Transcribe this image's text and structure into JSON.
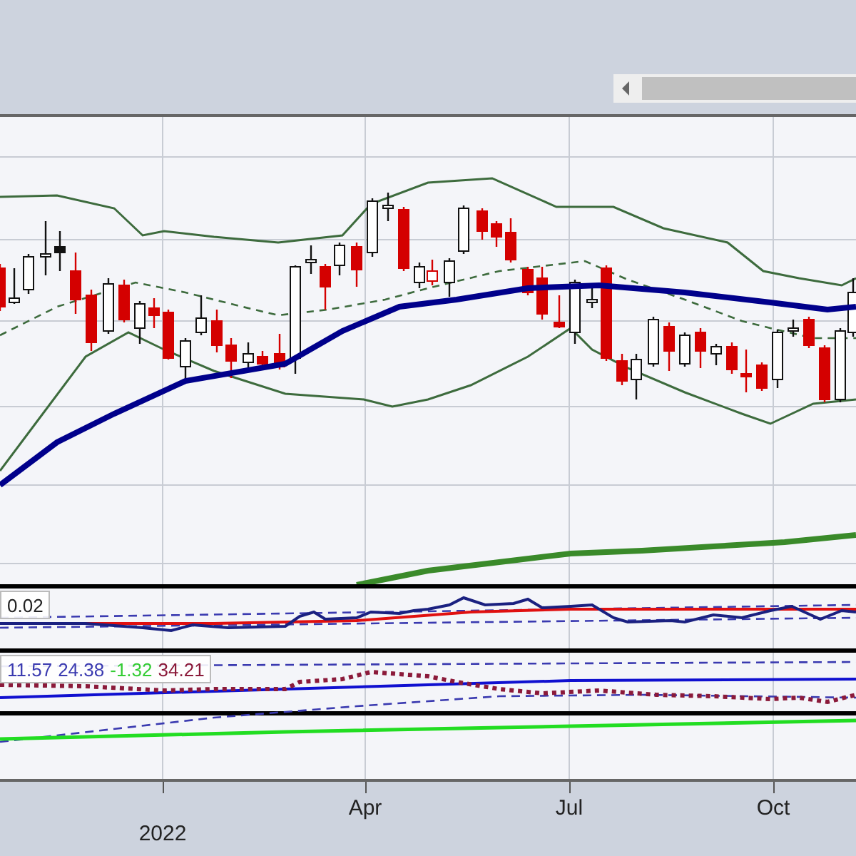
{
  "indicator_panels": [
    {
      "legend": [
        {
          "text": "0.02",
          "color": "#222222"
        }
      ]
    },
    {
      "legend": [
        {
          "text": "11.57",
          "color": "#3a3ab0"
        },
        {
          "text": "24.38",
          "color": "#3a3ab0"
        },
        {
          "text": "-1.32",
          "color": "#33cc33"
        },
        {
          "text": "34.21",
          "color": "#8b1a3a"
        }
      ]
    }
  ],
  "x_axis": {
    "labels": [
      {
        "text": "2022",
        "kind": "year"
      },
      {
        "text": "Apr",
        "kind": "month"
      },
      {
        "text": "Jul",
        "kind": "month"
      },
      {
        "text": "Oct",
        "kind": "month"
      }
    ]
  }
}
